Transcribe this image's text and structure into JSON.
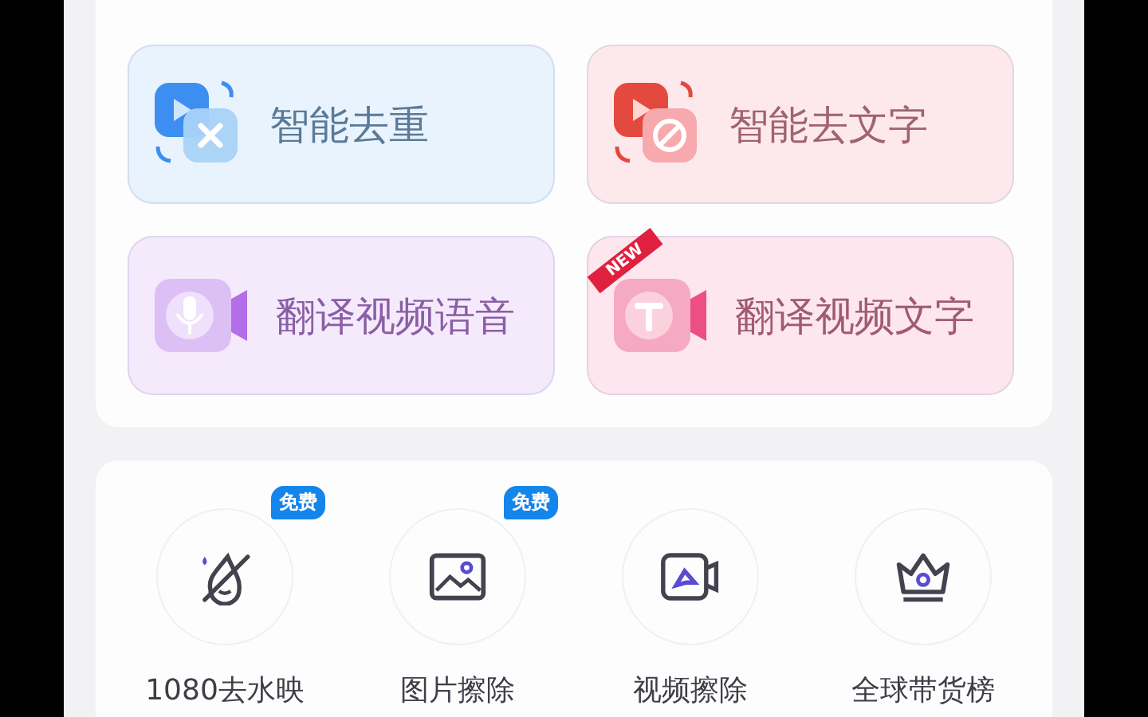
{
  "features": [
    {
      "label": "智能去重",
      "kind": "dedupe",
      "color": "#e8f3fd"
    },
    {
      "label": "智能去文字",
      "kind": "remove-text",
      "color": "#fde9ec"
    },
    {
      "label": "翻译视频语音",
      "kind": "translate-voice",
      "color": "#f5eafb"
    },
    {
      "label": "翻译视频文字",
      "kind": "translate-text",
      "color": "#fde6ee",
      "badge": "NEW"
    }
  ],
  "tools": [
    {
      "label": "1080去水映",
      "kind": "watermark",
      "badge": "免费"
    },
    {
      "label": "图片擦除",
      "kind": "image",
      "badge": "免费"
    },
    {
      "label": "视频擦除",
      "kind": "video"
    },
    {
      "label": "全球带货榜",
      "kind": "crown"
    }
  ]
}
